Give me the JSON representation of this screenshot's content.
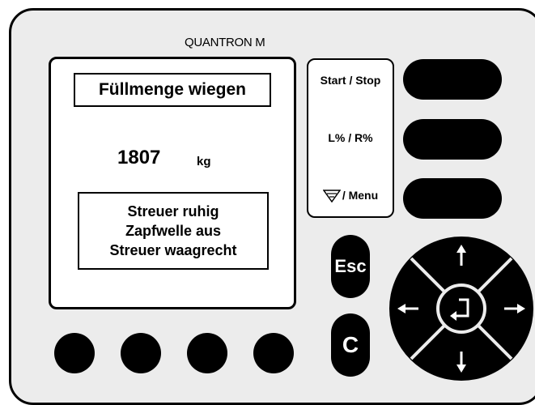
{
  "brand": "QUANTRON M",
  "display": {
    "title": "Füllmenge wiegen",
    "weight_value": "1807",
    "weight_unit": "kg",
    "message_lines": [
      "Streuer ruhig",
      "Zapfwelle aus",
      "Streuer waagrecht"
    ]
  },
  "function_labels": {
    "start_stop": "Start / Stop",
    "lr_percent": "L% / R%",
    "menu": "/ Menu"
  },
  "buttons": {
    "esc": "Esc",
    "c": "C"
  },
  "icons": {
    "filter": "filter-icon",
    "enter": "enter-icon",
    "arrows": [
      "arrow-up-icon",
      "arrow-down-icon",
      "arrow-left-icon",
      "arrow-right-icon"
    ]
  },
  "colors": {
    "panel": "#ececec",
    "keys": "#000000",
    "display": "#ffffff"
  }
}
